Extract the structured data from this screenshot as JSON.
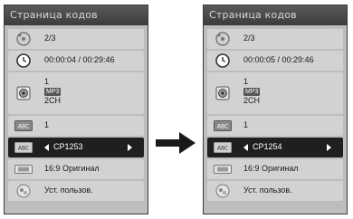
{
  "arrow_icon": "right-arrow",
  "panels": [
    {
      "title": "Страница кодов",
      "chapter": "2/3",
      "time": "00:00:04 / 00:29:46",
      "audio_track": "1",
      "audio_format": "MP3",
      "audio_channels": "2CH",
      "subtitle": "1",
      "code_page": "CP1253",
      "aspect": "16:9 Оригинал",
      "user_setting": "Уст. пользов."
    },
    {
      "title": "Страница кодов",
      "chapter": "2/3",
      "time": "00:00:05 / 00:29:46",
      "audio_track": "1",
      "audio_format": "MP3",
      "audio_channels": "2CH",
      "subtitle": "1",
      "code_page": "CP1254",
      "aspect": "16:9 Оригинал",
      "user_setting": "Уст. пользов."
    }
  ]
}
